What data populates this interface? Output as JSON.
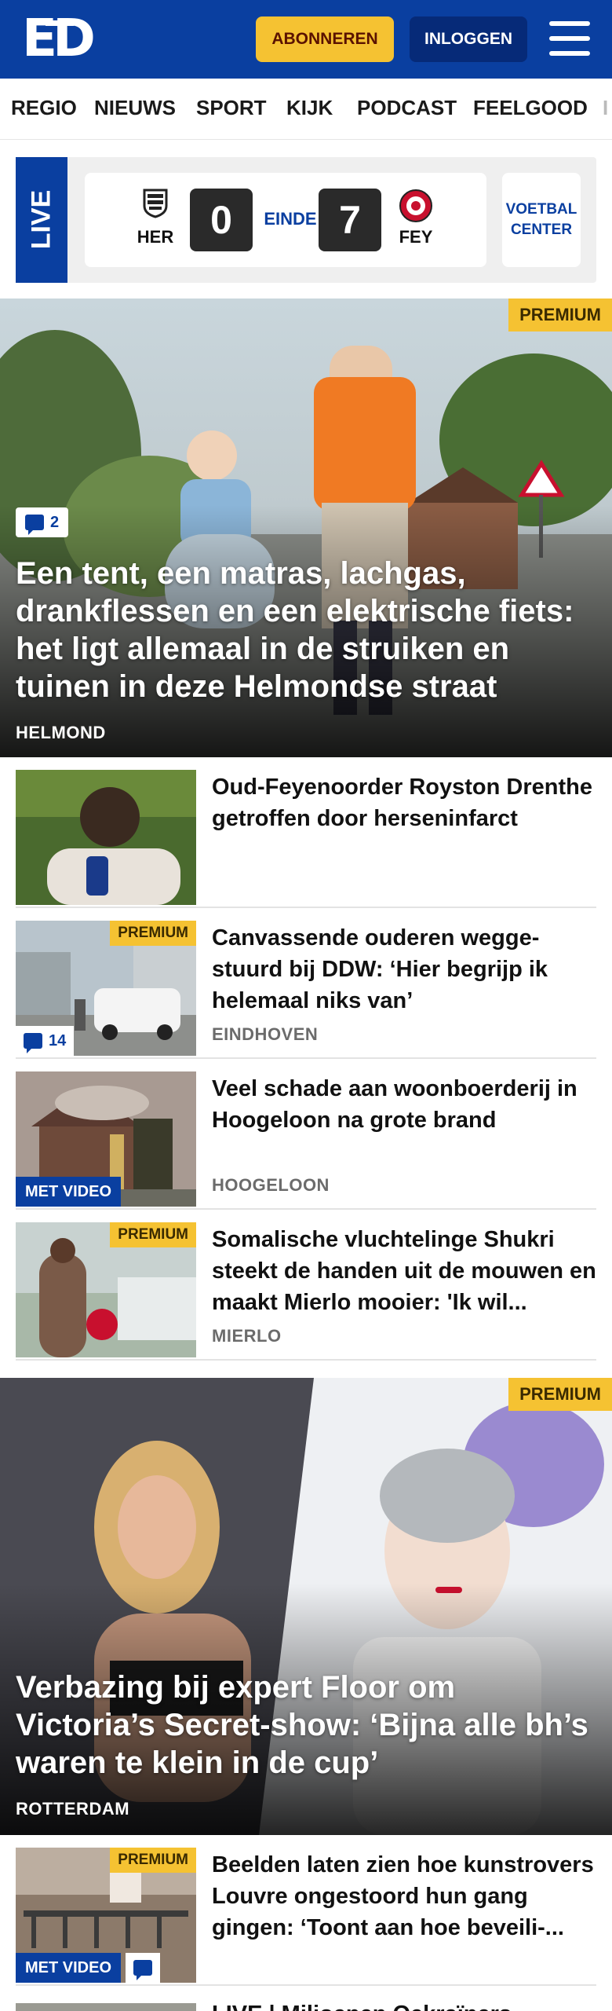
{
  "header": {
    "logo": "ED",
    "subscribe_label": "ABONNEREN",
    "login_label": "INLOGGEN"
  },
  "nav": {
    "items": [
      "REGIO",
      "NIEUWS",
      "SPORT",
      "KIJK",
      "PODCAST",
      "FEELGOOD"
    ]
  },
  "live": {
    "tag": "LIVE",
    "home": "HER",
    "home_score": "0",
    "status": "EINDE",
    "away_score": "7",
    "away": "FEY",
    "center_line1": "VOETBAL",
    "center_line2": "CENTER"
  },
  "hero1": {
    "premium": "PREMIUM",
    "comments": "2",
    "title": "Een tent, een matras, lachgas, drankflessen en een elektrische fiets: het ligt allemaal in de struiken en tuinen in deze Helmondse straat",
    "location": "HELMOND"
  },
  "articles": [
    {
      "title": "Oud-Feyenoorder Royston Drenthe getroffen door hersenin­farct",
      "location": "",
      "premium": "",
      "comments": "",
      "video": ""
    },
    {
      "title": "Canvassende ouderen wegge­stuurd bij DDW: ‘Hier begrijp ik helemaal niks van’",
      "location": "EINDHOVEN",
      "premium": "PREMIUM",
      "comments": "14",
      "video": ""
    },
    {
      "title": "Veel schade aan woonboerderij in Hoogeloon na grote brand",
      "location": "HOOGELOON",
      "premium": "",
      "comments": "",
      "video": "MET VIDEO"
    },
    {
      "title": "Somalische vluchtelinge Shukri steekt de handen uit de mouwen en maakt Mierlo mooier: 'Ik wil...",
      "location": "MIERLO",
      "premium": "PREMIUM",
      "comments": "",
      "video": ""
    }
  ],
  "hero2": {
    "premium": "PREMIUM",
    "title": "Verbazing bij expert Floor om Victoria’s Secret-show: ‘Bijna alle bh’s waren te klein in de cup’",
    "location": "ROTTERDAM"
  },
  "article_last": {
    "title": "Beelden laten zien hoe kunstro­vers Louvre ongestoord hun gang gingen: ‘Toont aan hoe beveili-...",
    "premium": "PREMIUM",
    "video": "MET VIDEO"
  },
  "partial_next": {
    "title": "LIVE | Miljoenen Oekraïners..."
  },
  "colors": {
    "brand_blue": "#0a3fa0",
    "accent_yellow": "#f5c232"
  }
}
